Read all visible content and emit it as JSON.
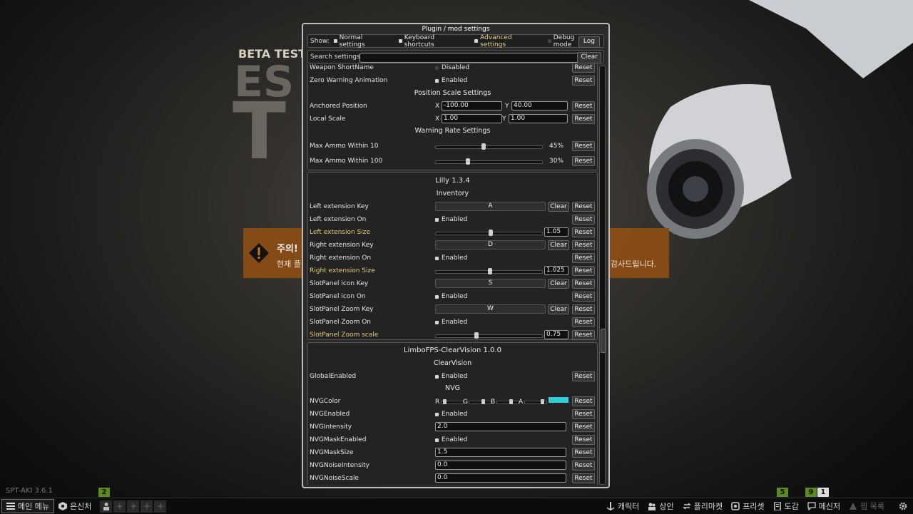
{
  "background": {
    "logo_beta": "BETA TEST",
    "logo_word1": "ES",
    "logo_word2": "T",
    "warning_title": "주의!",
    "warning_line": "현재 플",
    "warning_right": "감사드립니다.",
    "version": "SPT-AKI 3.6.1"
  },
  "badges": {
    "b1": "2",
    "b2": "5",
    "b3": "9",
    "b4": "1"
  },
  "bottom_bar": {
    "main_menu": "메인 메뉴",
    "hideout": "은신처",
    "character": "캐릭터",
    "traders": "상인",
    "flea": "플리마켓",
    "presets": "프리셋",
    "handbook": "도감",
    "messenger": "메신저",
    "watchlist": "찜 목록",
    "plus": "+"
  },
  "window": {
    "title": "Plugin / mod settings",
    "show_label": "Show:",
    "options": [
      {
        "label": "Normal settings",
        "on": true
      },
      {
        "label": "Keyboard shortcuts",
        "on": true
      },
      {
        "label": "Advanced settings",
        "on": true
      },
      {
        "label": "Debug mode",
        "on": false
      }
    ],
    "log_label": "Log",
    "search_label": "Search settings:",
    "search_value": "",
    "clear_label": "Clear",
    "reset_label": "Reset",
    "key_clear_label": "Clear"
  },
  "sec1": {
    "rows": {
      "weapon_shortname": {
        "label": "Weapon ShortName",
        "value": "Disabled"
      },
      "zero_warning": {
        "label": "Zero Warning Animation",
        "value": "Enabled"
      }
    },
    "position_scale_title": "Position Scale Settings",
    "anchored_label": "Anchored Position",
    "anchored_x": "-100.00",
    "anchored_y": "40.00",
    "local_scale_label": "Local Scale",
    "local_x": "1.00",
    "local_y": "1.00",
    "x_lbl": "X",
    "y_lbl": "Y",
    "warning_rate_title": "Warning Rate Settings",
    "max10_label": "Max Ammo Within 10",
    "max10_value": "45%",
    "max10_fraction": 0.45,
    "max100_label": "Max Ammo Within 100",
    "max100_value": "30%",
    "max100_fraction": 0.3
  },
  "sec2": {
    "title": "Lilly 1.3.4",
    "subtitle": "Inventory",
    "left_key_label": "Left extension Key",
    "left_key": "A",
    "left_on_label": "Left extension On",
    "left_on": "Enabled",
    "left_size_label": "Left extension Size",
    "left_size": "1.05",
    "left_size_fraction": 0.52,
    "right_key_label": "Right extension Key",
    "right_key": "D",
    "right_on_label": "Right extension On",
    "right_on": "Enabled",
    "right_size_label": "Right extension Size",
    "right_size": "1.025",
    "right_size_fraction": 0.51,
    "slot_icon_key_label": "SlotPanel icon Key",
    "slot_icon_key": "S",
    "slot_icon_on_label": "SlotPanel icon On",
    "slot_icon_on": "Enabled",
    "slot_zoom_key_label": "SlotPanel Zoom Key",
    "slot_zoom_key": "W",
    "slot_zoom_on_label": "SlotPanel Zoom On",
    "slot_zoom_on": "Enabled",
    "slot_zoom_scale_label": "SlotPanel Zoom scale",
    "slot_zoom_scale": "0.75",
    "slot_zoom_scale_fraction": 0.38
  },
  "sec3": {
    "title": "LimboFPS-ClearVision 1.0.0",
    "subtitle": "ClearVision",
    "global_label": "GlobalEnabled",
    "global_value": "Enabled",
    "nvg_title": "NVG",
    "nvg_color_label": "NVGColor",
    "r": "R",
    "g": "G",
    "b": "B",
    "a": "A",
    "swatch_color": "#2ecfd8",
    "nvg_enabled_label": "NVGEnabled",
    "nvg_enabled": "Enabled",
    "nvg_intensity_label": "NVGIntensity",
    "nvg_intensity": "2.0",
    "nvg_mask_enabled_label": "NVGMaskEnabled",
    "nvg_mask_enabled": "Enabled",
    "nvg_mask_size_label": "NVGMaskSize",
    "nvg_mask_size": "1.5",
    "nvg_noise_int_label": "NVGNoiseIntensity",
    "nvg_noise_int": "0.0",
    "nvg_noise_scale_label": "NVGNoiseScale",
    "nvg_noise_scale": "0.0"
  }
}
